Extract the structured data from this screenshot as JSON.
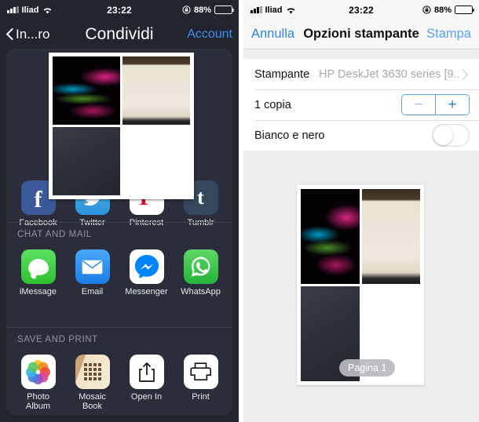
{
  "left_screen": {
    "status_bar": {
      "signal_icon": "signal-bars-icon",
      "carrier": "Iliad",
      "wifi_icon": "wifi-icon",
      "time": "23:22",
      "rotation_lock_icon": "rotation-lock-icon",
      "battery_percent": "88%",
      "battery_icon": "battery-icon"
    },
    "nav": {
      "back_label": "In...ro",
      "back_icon": "chevron-left-icon",
      "title": "Condividi",
      "right_action": "Account"
    },
    "preview": {
      "tiles": [
        {
          "name": "abstract-light-streaks"
        },
        {
          "name": "wall-photo"
        },
        {
          "name": "dark-surface-photo"
        },
        {
          "name": "blank-white"
        }
      ]
    },
    "sections": [
      {
        "id": "social",
        "header": "",
        "apps": [
          {
            "label": "Facebook",
            "icon": "facebook-icon"
          },
          {
            "label": "Twitter",
            "icon": "twitter-icon"
          },
          {
            "label": "Pinterest",
            "icon": "pinterest-icon"
          },
          {
            "label": "Tumblr",
            "icon": "tumblr-icon"
          }
        ]
      },
      {
        "id": "chat_mail",
        "header": "CHAT AND MAIL",
        "apps": [
          {
            "label": "iMessage",
            "icon": "imessage-icon"
          },
          {
            "label": "Email",
            "icon": "email-icon"
          },
          {
            "label": "Messenger",
            "icon": "messenger-icon"
          },
          {
            "label": "WhatsApp",
            "icon": "whatsapp-icon"
          }
        ]
      },
      {
        "id": "save_print",
        "header": "SAVE AND PRINT",
        "apps": [
          {
            "label": "Photo\nAlbum",
            "icon": "photos-icon"
          },
          {
            "label": "Mosaic\nBook",
            "icon": "mosaic-book-icon"
          },
          {
            "label": "Open In",
            "icon": "share-out-icon"
          },
          {
            "label": "Print",
            "icon": "printer-icon"
          }
        ]
      }
    ]
  },
  "right_screen": {
    "status_bar": {
      "signal_icon": "signal-bars-icon",
      "carrier": "Iliad",
      "wifi_icon": "wifi-icon",
      "time": "23:22",
      "rotation_lock_icon": "rotation-lock-icon",
      "battery_percent": "88%",
      "battery_icon": "battery-icon"
    },
    "nav": {
      "cancel": "Annulla",
      "title": "Opzioni stampante",
      "print": "Stampa"
    },
    "options": {
      "printer_label": "Stampante",
      "printer_value": "HP DeskJet 3630 series [9...",
      "chevron_icon": "chevron-right-icon",
      "copies_label": "1 copia",
      "stepper_minus": "−",
      "stepper_plus": "+",
      "bw_label": "Bianco e nero",
      "bw_state": "off"
    },
    "preview": {
      "page_badge": "Pagina 1",
      "tiles": [
        {
          "name": "abstract-light-streaks"
        },
        {
          "name": "wall-photo"
        },
        {
          "name": "dark-surface-photo"
        },
        {
          "name": "blank-white"
        }
      ]
    }
  },
  "colors": {
    "dark_bg": "#22242e",
    "card_bg": "#2b2e3a",
    "accent_blue": "#3e8ef0",
    "light_bg": "#ececed",
    "ios_blue": "#2f84e8"
  }
}
